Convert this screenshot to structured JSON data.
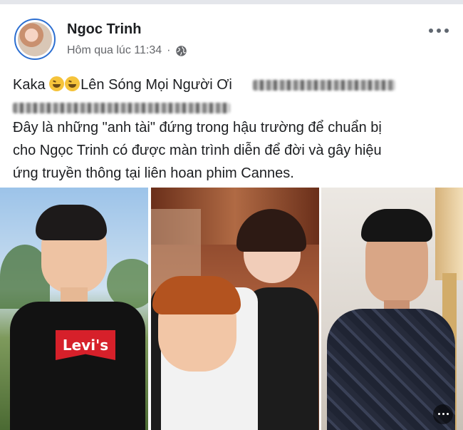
{
  "post": {
    "author": "Ngoc Trinh",
    "timestamp": "Hôm qua lúc 11:34",
    "separator": "·",
    "privacy_icon": "globe-icon",
    "more_icon": "more-options-icon",
    "text_line1_prefix": "Kaka",
    "emoji": "rolling-on-floor-laughing-emoji",
    "text_line1_main": "Lên Sóng Mọi Người Ơi",
    "text_line3": "Đây là những \"anh tài\" đứng trong hậu trường để chuẩn bị",
    "text_line4": "cho Ngọc Trinh có được màn trình diễn để đời và gây hiệu",
    "text_line5": "ứng truyền thông tại liên hoan phim Cannes.",
    "photos": [
      {
        "shirt_text": "Levi's"
      },
      {},
      {}
    ]
  },
  "colors": {
    "accent": "#2d6fd1",
    "secondary_text": "#65676b",
    "primary_text": "#1c1e21"
  }
}
